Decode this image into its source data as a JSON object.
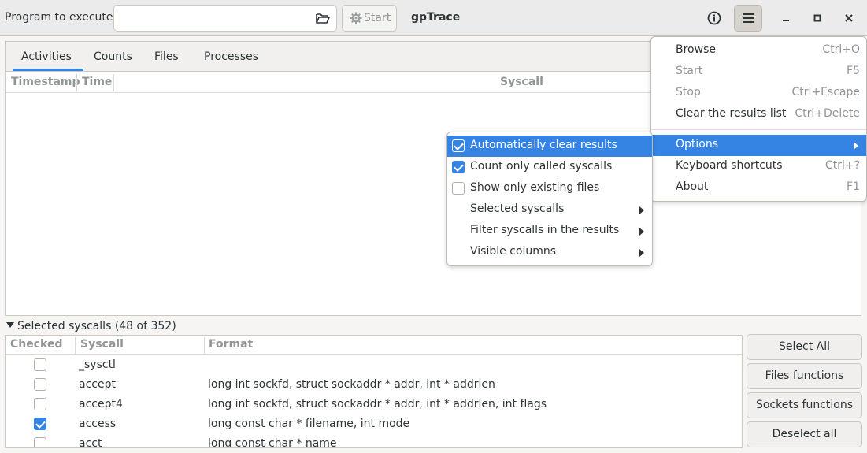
{
  "header": {
    "program_label": "Program to execute:",
    "program_value": "",
    "start_label": "Start",
    "app_title": "gpTrace"
  },
  "tabs": [
    {
      "label": "Activities",
      "active": true
    },
    {
      "label": "Counts",
      "active": false
    },
    {
      "label": "Files",
      "active": false
    },
    {
      "label": "Processes",
      "active": false
    }
  ],
  "activities_columns": [
    "Timestamp",
    "Time",
    "Syscall"
  ],
  "expander_label": "Selected syscalls (48 of 352)",
  "syscalls": {
    "columns": [
      "Checked",
      "Syscall",
      "Format"
    ],
    "rows": [
      {
        "checked": false,
        "name": "_sysctl",
        "format": ""
      },
      {
        "checked": false,
        "name": "accept",
        "format": "long int sockfd, struct sockaddr * addr, int * addrlen"
      },
      {
        "checked": false,
        "name": "accept4",
        "format": "long int sockfd, struct sockaddr * addr, int * addrlen, int flags"
      },
      {
        "checked": true,
        "name": "access",
        "format": "long const char * filename, int mode"
      },
      {
        "checked": false,
        "name": "acct",
        "format": "long const char * name"
      }
    ]
  },
  "side_buttons": [
    "Select All",
    "Files functions",
    "Sockets functions",
    "Deselect all"
  ],
  "menu": {
    "items": [
      {
        "label": "Browse",
        "accel": "Ctrl+O",
        "disabled": false
      },
      {
        "label": "Start",
        "accel": "F5",
        "disabled": true
      },
      {
        "label": "Stop",
        "accel": "Ctrl+Escape",
        "disabled": true
      },
      {
        "label": "Clear the results list",
        "accel": "Ctrl+Delete",
        "disabled": false
      },
      {
        "label": "Options",
        "accel": "",
        "disabled": false
      },
      {
        "label": "Keyboard shortcuts",
        "accel": "Ctrl+?",
        "disabled": false
      },
      {
        "label": "About",
        "accel": "F1",
        "disabled": false
      }
    ]
  },
  "options_submenu": {
    "items": [
      {
        "label": "Automatically clear results",
        "checked": true,
        "has_sub": false
      },
      {
        "label": "Count only called syscalls",
        "checked": true,
        "has_sub": false
      },
      {
        "label": "Show only existing files",
        "checked": false,
        "has_sub": false
      },
      {
        "label": "Selected syscalls",
        "has_sub": true
      },
      {
        "label": "Filter syscalls in the results",
        "has_sub": true
      },
      {
        "label": "Visible columns",
        "has_sub": true
      }
    ]
  },
  "colors": {
    "accent": "#3584e4",
    "dim_text": "#929595"
  }
}
